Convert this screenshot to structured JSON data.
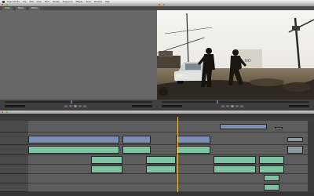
{
  "menubar": {
    "app": "Final Cut Pro",
    "items": [
      "File",
      "Edit",
      "View",
      "Mark",
      "Modify",
      "Sequence",
      "Effects",
      "Tools",
      "Window",
      "Help"
    ]
  },
  "viewer": {
    "tabs": [
      "Video",
      "Filters",
      "Motion"
    ]
  },
  "canvas": {},
  "timeline": {}
}
